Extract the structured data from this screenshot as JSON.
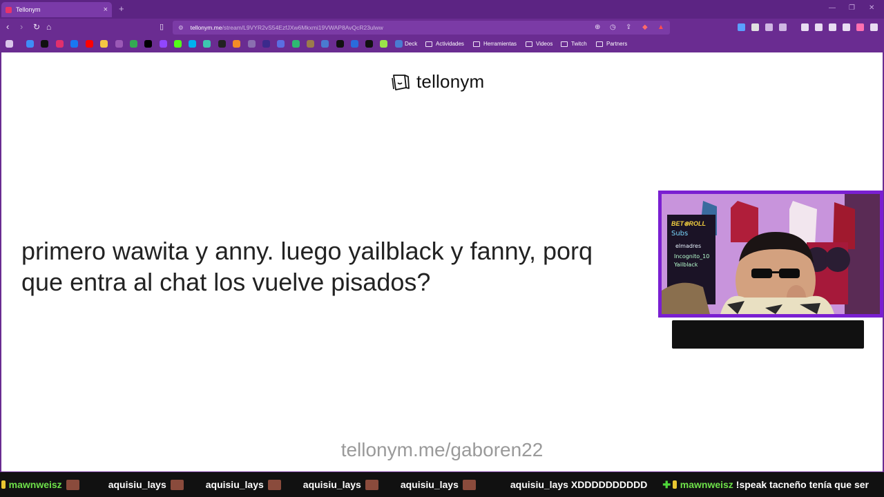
{
  "browser": {
    "tab_title": "Tellonym",
    "tab_close": "×",
    "new_tab": "+",
    "url_host": "tellonym.me",
    "url_path": "/stream/L9VYR2vS54EzfJXw6Mkxmi19VWAP8AvQcR23ulww"
  },
  "bookmarks": {
    "folders": [
      "Deck",
      "Actividades",
      "Herramientas",
      "Videos",
      "Twitch",
      "Partners"
    ]
  },
  "page": {
    "logo_text": "tellonym",
    "question_line1": "primero wawita y anny. luego  yailblack y fanny, porq",
    "question_line2": "que entra al chat los vuelve pisados?",
    "footer_link": "tellonym.me/gaboren22"
  },
  "webcam": {
    "overlay_text_1": "BET⊗ROLL",
    "overlay_text_2": "Subs",
    "overlay_text_3": "elmadres",
    "overlay_text_4": "Incognito_10",
    "overlay_text_5": "Yailblack"
  },
  "chat": {
    "items": [
      {
        "user": "mawnweisz",
        "message": "",
        "green": true
      },
      {
        "user": "aquisiu_lays",
        "message": "",
        "green": false
      },
      {
        "user": "aquisiu_lays",
        "message": "",
        "green": false
      },
      {
        "user": "aquisiu_lays",
        "message": "",
        "green": false
      },
      {
        "user": "aquisiu_lays",
        "message": "",
        "green": false
      },
      {
        "user": "aquisiu_lays",
        "message": "XDDDDDDDDDD",
        "green": false
      },
      {
        "user": "mawnweisz",
        "message": "!speak tacneño tenía que ser",
        "green": true
      }
    ]
  },
  "colors": {
    "browser_chrome": "#6a2c91",
    "tab_active": "#7a3aa8",
    "cam_border": "#7a1fd1",
    "chat_green": "#6ee04a"
  }
}
